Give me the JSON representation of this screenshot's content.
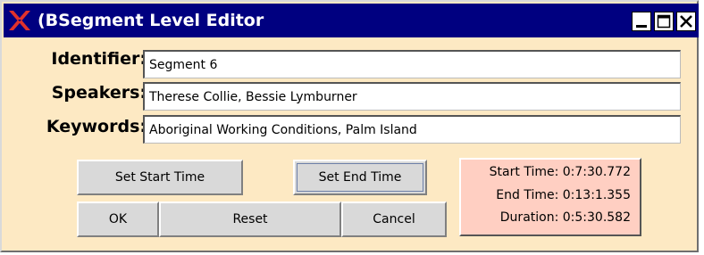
{
  "window": {
    "title": "(BSegment Level Editor",
    "controls": {
      "minimize": "minimize-icon",
      "maximize": "maximize-icon",
      "close": "close-icon"
    }
  },
  "form": {
    "identifier": {
      "label": "Identifier:",
      "value": "Segment 6"
    },
    "speakers": {
      "label": "Speakers:",
      "value": "Therese Collie, Bessie Lymburner"
    },
    "keywords": {
      "label": "Keywords:",
      "value": "Aboriginal Working Conditions, Palm Island"
    }
  },
  "buttons": {
    "set_start": "Set Start Time",
    "set_end": "Set End Time",
    "ok": "OK",
    "reset": "Reset",
    "cancel": "Cancel"
  },
  "times": {
    "start": "Start Time: 0:7:30.772",
    "end": "End Time: 0:13:1.355",
    "duration": "Duration: 0:5:30.582"
  },
  "colors": {
    "titlebar": "#000080",
    "window_bg": "#fde9c3",
    "time_box_bg": "#ffcfc2",
    "x_logo": "#e0322c"
  }
}
